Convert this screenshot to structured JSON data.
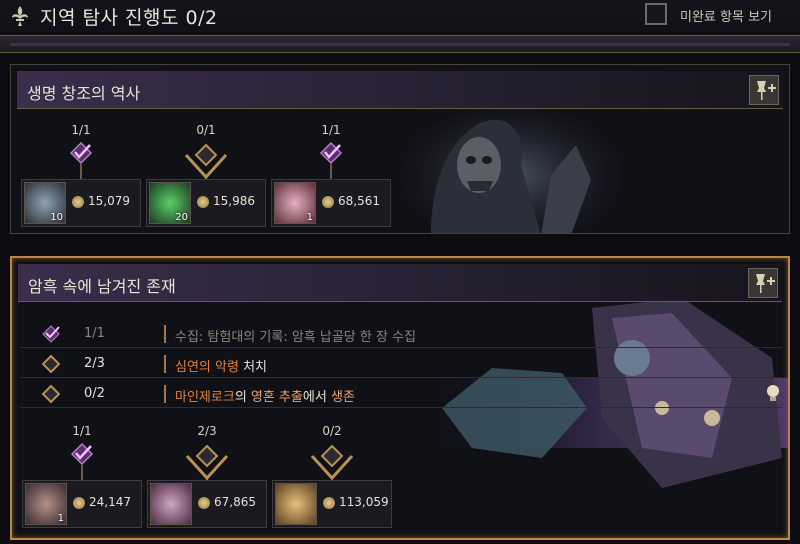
{
  "header": {
    "title": "지역 탐사 진행도  0/2",
    "toggle_label": "미완료 항목 보기"
  },
  "sections": [
    {
      "title": "생명 창조의 역사",
      "tiers": [
        {
          "progress": "1/1",
          "state": "complete",
          "reward_qty": "10",
          "amount": "15,079"
        },
        {
          "progress": "0/1",
          "state": "incomplete",
          "reward_qty": "20",
          "amount": "15,986"
        },
        {
          "progress": "1/1",
          "state": "complete",
          "reward_qty": "1",
          "amount": "68,561"
        }
      ]
    },
    {
      "title": "암흑 속에 남겨진 존재",
      "objectives": [
        {
          "progress": "1/1",
          "state": "complete",
          "desc_a": "수집: 탐험대의 기록: 암흑 납골당",
          "desc_b": " 한 장 수집"
        },
        {
          "progress": "2/3",
          "state": "incomplete",
          "desc_a": "심연의 악령",
          "desc_b": " 처치"
        },
        {
          "progress": "0/2",
          "state": "incomplete",
          "desc_a": "마인제로크",
          "desc_b": "의 ",
          "desc_c": "영혼 추출",
          "desc_d": "에서 ",
          "desc_e": "생존"
        }
      ],
      "tiers": [
        {
          "progress": "1/1",
          "state": "complete",
          "reward_qty": "1",
          "amount": "24,147"
        },
        {
          "progress": "2/3",
          "state": "incomplete",
          "reward_qty": "",
          "amount": "67,865"
        },
        {
          "progress": "0/2",
          "state": "incomplete",
          "reward_qty": "",
          "amount": "113,059"
        }
      ]
    }
  ],
  "icons": {
    "header": "fleur-de-lis-icon",
    "toggle": "checkbox-icon",
    "pin": "pin-add-icon",
    "complete": "check-diamond-icon",
    "incomplete": "diamond-icon",
    "coin": "gold-coin-icon",
    "hint": "lightbulb-icon"
  },
  "colors": {
    "gold_border": "#b88a45",
    "highlight": "#e0813c",
    "complete_purple": "#c46ad8",
    "text": "#e6e1d6"
  }
}
